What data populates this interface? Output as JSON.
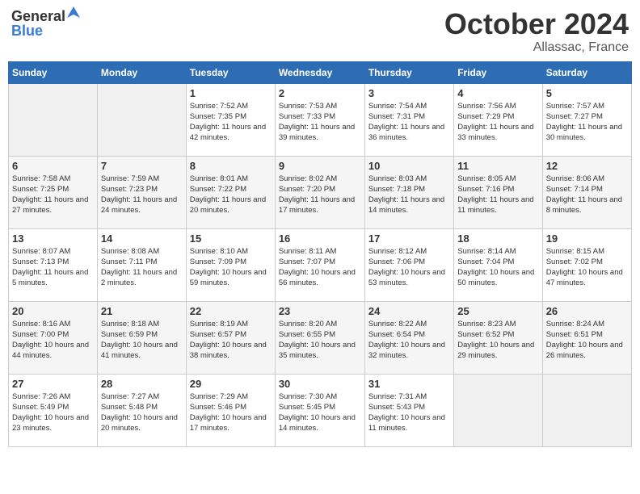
{
  "header": {
    "logo_general": "General",
    "logo_blue": "Blue",
    "month_title": "October 2024",
    "location": "Allassac, France"
  },
  "weekdays": [
    "Sunday",
    "Monday",
    "Tuesday",
    "Wednesday",
    "Thursday",
    "Friday",
    "Saturday"
  ],
  "weeks": [
    [
      {
        "day": "",
        "sunrise": "",
        "sunset": "",
        "daylight": ""
      },
      {
        "day": "",
        "sunrise": "",
        "sunset": "",
        "daylight": ""
      },
      {
        "day": "1",
        "sunrise": "Sunrise: 7:52 AM",
        "sunset": "Sunset: 7:35 PM",
        "daylight": "Daylight: 11 hours and 42 minutes."
      },
      {
        "day": "2",
        "sunrise": "Sunrise: 7:53 AM",
        "sunset": "Sunset: 7:33 PM",
        "daylight": "Daylight: 11 hours and 39 minutes."
      },
      {
        "day": "3",
        "sunrise": "Sunrise: 7:54 AM",
        "sunset": "Sunset: 7:31 PM",
        "daylight": "Daylight: 11 hours and 36 minutes."
      },
      {
        "day": "4",
        "sunrise": "Sunrise: 7:56 AM",
        "sunset": "Sunset: 7:29 PM",
        "daylight": "Daylight: 11 hours and 33 minutes."
      },
      {
        "day": "5",
        "sunrise": "Sunrise: 7:57 AM",
        "sunset": "Sunset: 7:27 PM",
        "daylight": "Daylight: 11 hours and 30 minutes."
      }
    ],
    [
      {
        "day": "6",
        "sunrise": "Sunrise: 7:58 AM",
        "sunset": "Sunset: 7:25 PM",
        "daylight": "Daylight: 11 hours and 27 minutes."
      },
      {
        "day": "7",
        "sunrise": "Sunrise: 7:59 AM",
        "sunset": "Sunset: 7:23 PM",
        "daylight": "Daylight: 11 hours and 24 minutes."
      },
      {
        "day": "8",
        "sunrise": "Sunrise: 8:01 AM",
        "sunset": "Sunset: 7:22 PM",
        "daylight": "Daylight: 11 hours and 20 minutes."
      },
      {
        "day": "9",
        "sunrise": "Sunrise: 8:02 AM",
        "sunset": "Sunset: 7:20 PM",
        "daylight": "Daylight: 11 hours and 17 minutes."
      },
      {
        "day": "10",
        "sunrise": "Sunrise: 8:03 AM",
        "sunset": "Sunset: 7:18 PM",
        "daylight": "Daylight: 11 hours and 14 minutes."
      },
      {
        "day": "11",
        "sunrise": "Sunrise: 8:05 AM",
        "sunset": "Sunset: 7:16 PM",
        "daylight": "Daylight: 11 hours and 11 minutes."
      },
      {
        "day": "12",
        "sunrise": "Sunrise: 8:06 AM",
        "sunset": "Sunset: 7:14 PM",
        "daylight": "Daylight: 11 hours and 8 minutes."
      }
    ],
    [
      {
        "day": "13",
        "sunrise": "Sunrise: 8:07 AM",
        "sunset": "Sunset: 7:13 PM",
        "daylight": "Daylight: 11 hours and 5 minutes."
      },
      {
        "day": "14",
        "sunrise": "Sunrise: 8:08 AM",
        "sunset": "Sunset: 7:11 PM",
        "daylight": "Daylight: 11 hours and 2 minutes."
      },
      {
        "day": "15",
        "sunrise": "Sunrise: 8:10 AM",
        "sunset": "Sunset: 7:09 PM",
        "daylight": "Daylight: 10 hours and 59 minutes."
      },
      {
        "day": "16",
        "sunrise": "Sunrise: 8:11 AM",
        "sunset": "Sunset: 7:07 PM",
        "daylight": "Daylight: 10 hours and 56 minutes."
      },
      {
        "day": "17",
        "sunrise": "Sunrise: 8:12 AM",
        "sunset": "Sunset: 7:06 PM",
        "daylight": "Daylight: 10 hours and 53 minutes."
      },
      {
        "day": "18",
        "sunrise": "Sunrise: 8:14 AM",
        "sunset": "Sunset: 7:04 PM",
        "daylight": "Daylight: 10 hours and 50 minutes."
      },
      {
        "day": "19",
        "sunrise": "Sunrise: 8:15 AM",
        "sunset": "Sunset: 7:02 PM",
        "daylight": "Daylight: 10 hours and 47 minutes."
      }
    ],
    [
      {
        "day": "20",
        "sunrise": "Sunrise: 8:16 AM",
        "sunset": "Sunset: 7:00 PM",
        "daylight": "Daylight: 10 hours and 44 minutes."
      },
      {
        "day": "21",
        "sunrise": "Sunrise: 8:18 AM",
        "sunset": "Sunset: 6:59 PM",
        "daylight": "Daylight: 10 hours and 41 minutes."
      },
      {
        "day": "22",
        "sunrise": "Sunrise: 8:19 AM",
        "sunset": "Sunset: 6:57 PM",
        "daylight": "Daylight: 10 hours and 38 minutes."
      },
      {
        "day": "23",
        "sunrise": "Sunrise: 8:20 AM",
        "sunset": "Sunset: 6:55 PM",
        "daylight": "Daylight: 10 hours and 35 minutes."
      },
      {
        "day": "24",
        "sunrise": "Sunrise: 8:22 AM",
        "sunset": "Sunset: 6:54 PM",
        "daylight": "Daylight: 10 hours and 32 minutes."
      },
      {
        "day": "25",
        "sunrise": "Sunrise: 8:23 AM",
        "sunset": "Sunset: 6:52 PM",
        "daylight": "Daylight: 10 hours and 29 minutes."
      },
      {
        "day": "26",
        "sunrise": "Sunrise: 8:24 AM",
        "sunset": "Sunset: 6:51 PM",
        "daylight": "Daylight: 10 hours and 26 minutes."
      }
    ],
    [
      {
        "day": "27",
        "sunrise": "Sunrise: 7:26 AM",
        "sunset": "Sunset: 5:49 PM",
        "daylight": "Daylight: 10 hours and 23 minutes."
      },
      {
        "day": "28",
        "sunrise": "Sunrise: 7:27 AM",
        "sunset": "Sunset: 5:48 PM",
        "daylight": "Daylight: 10 hours and 20 minutes."
      },
      {
        "day": "29",
        "sunrise": "Sunrise: 7:29 AM",
        "sunset": "Sunset: 5:46 PM",
        "daylight": "Daylight: 10 hours and 17 minutes."
      },
      {
        "day": "30",
        "sunrise": "Sunrise: 7:30 AM",
        "sunset": "Sunset: 5:45 PM",
        "daylight": "Daylight: 10 hours and 14 minutes."
      },
      {
        "day": "31",
        "sunrise": "Sunrise: 7:31 AM",
        "sunset": "Sunset: 5:43 PM",
        "daylight": "Daylight: 10 hours and 11 minutes."
      },
      {
        "day": "",
        "sunrise": "",
        "sunset": "",
        "daylight": ""
      },
      {
        "day": "",
        "sunrise": "",
        "sunset": "",
        "daylight": ""
      }
    ]
  ]
}
